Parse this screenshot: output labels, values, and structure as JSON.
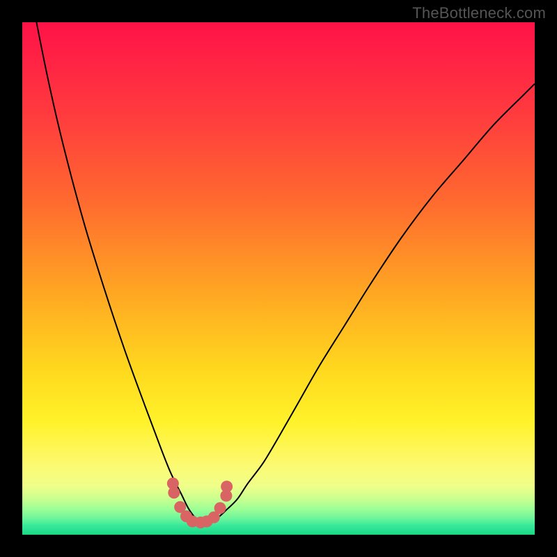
{
  "watermark": "TheBottleneck.com",
  "chart_data": {
    "type": "line",
    "title": "",
    "xlabel": "",
    "ylabel": "",
    "xlim": [
      0,
      100
    ],
    "ylim": [
      0,
      100
    ],
    "grid": false,
    "series": [
      {
        "name": "curve",
        "x": [
          0,
          2,
          5,
          8,
          12,
          16,
          20,
          24,
          27,
          29,
          31,
          32.5,
          34,
          35,
          36,
          38,
          40,
          42,
          44,
          47,
          50,
          54,
          58,
          63,
          68,
          74,
          80,
          86,
          92,
          98,
          100
        ],
        "y": [
          115,
          104,
          89,
          76,
          61,
          48,
          36,
          25,
          17,
          12,
          8,
          5,
          3,
          2.2,
          2.2,
          3.2,
          5,
          7,
          10,
          14,
          19,
          26,
          33,
          41,
          49,
          58,
          66,
          73,
          80,
          86,
          88
        ]
      },
      {
        "name": "dots",
        "x": [
          29.4,
          29.6,
          30.8,
          32.0,
          33.2,
          34.8,
          36.0,
          37.4,
          38.6,
          39.8,
          39.9
        ],
        "y": [
          10.0,
          8.2,
          5.4,
          3.6,
          2.6,
          2.4,
          2.6,
          3.4,
          5.2,
          7.6,
          9.4
        ]
      }
    ],
    "background_gradient": {
      "stops": [
        {
          "offset": 0.0,
          "color": "#ff1248"
        },
        {
          "offset": 0.18,
          "color": "#ff3b3e"
        },
        {
          "offset": 0.35,
          "color": "#ff6a2f"
        },
        {
          "offset": 0.52,
          "color": "#ffa423"
        },
        {
          "offset": 0.68,
          "color": "#ffd91e"
        },
        {
          "offset": 0.78,
          "color": "#fff22a"
        },
        {
          "offset": 0.86,
          "color": "#fdf96e"
        },
        {
          "offset": 0.905,
          "color": "#efff8a"
        },
        {
          "offset": 0.93,
          "color": "#c9ff8f"
        },
        {
          "offset": 0.95,
          "color": "#9dff95"
        },
        {
          "offset": 0.968,
          "color": "#6df59a"
        },
        {
          "offset": 0.982,
          "color": "#38e99b"
        },
        {
          "offset": 1.0,
          "color": "#18d884"
        }
      ]
    },
    "dot_color": "#d86464",
    "curve_color": "#000000"
  }
}
